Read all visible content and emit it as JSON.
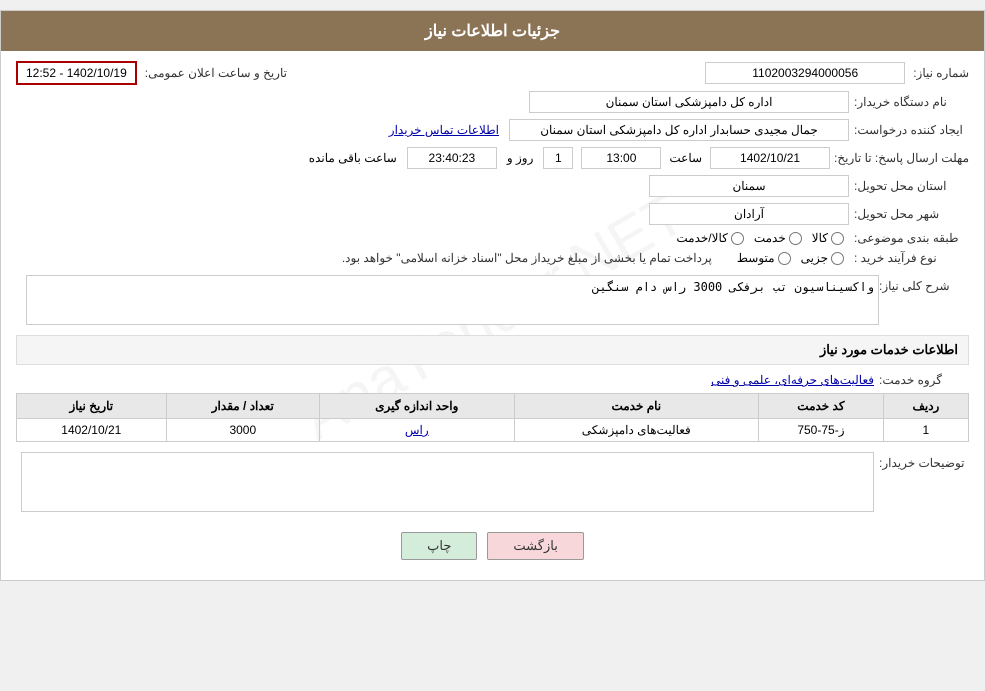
{
  "header": {
    "title": "جزئیات اطلاعات نیاز"
  },
  "labels": {
    "need_number": "شماره نیاز:",
    "buyer_org": "نام دستگاه خریدار:",
    "creator": "ایجاد کننده درخواست:",
    "deadline": "مهلت ارسال پاسخ: تا تاریخ:",
    "province": "استان محل تحویل:",
    "city": "شهر محل تحویل:",
    "category": "طبقه بندی موضوعی:",
    "purchase_type": "نوع فرآیند خرید :",
    "need_desc": "شرح کلی نیاز:",
    "services_info": "اطلاعات خدمات مورد نیاز",
    "service_group": "گروه خدمت:",
    "buyer_notes": "توضیحات خریدار:",
    "announce_date": "تاریخ و ساعت اعلان عمومی:",
    "contact_info": "اطلاعات تماس خریدار"
  },
  "values": {
    "need_number": "1102003294000056",
    "buyer_org": "اداره کل دامپزشکی استان سمنان",
    "creator": "جمال مجیدی حسابدار اداره کل دامپزشکی استان سمنان",
    "announce_date": "1402/10/19 - 12:52",
    "deadline_date": "1402/10/21",
    "deadline_time": "13:00",
    "deadline_days": "1",
    "deadline_remaining": "23:40:23",
    "province": "سمنان",
    "city": "آرادان",
    "category_goods": "کالا",
    "category_service": "خدمت",
    "category_both": "کالا/خدمت",
    "purchase_partial": "جزیی",
    "purchase_medium": "متوسط",
    "purchase_note": "پرداخت تمام یا بخشی از مبلغ خریداز محل \"اسناد خزانه اسلامی\" خواهد بود.",
    "need_desc_value": "واکسیناسیون تب برفکی 3000 راس دام سنگین",
    "service_group_value": "فعالیت‌های حرفه‌ای، علمی و فنی",
    "buyer_notes_value": "",
    "row_days_label": "روز و",
    "row_hours_label": "ساعت باقی مانده"
  },
  "table": {
    "headers": [
      "ردیف",
      "کد خدمت",
      "نام خدمت",
      "واحد اندازه گیری",
      "تعداد / مقدار",
      "تاریخ نیاز"
    ],
    "rows": [
      {
        "row": "1",
        "code": "ز-75-750",
        "name": "فعالیت‌های دامپزشکی",
        "unit": "راس",
        "quantity": "3000",
        "date": "1402/10/21"
      }
    ]
  },
  "buttons": {
    "print": "چاپ",
    "back": "بازگشت"
  }
}
